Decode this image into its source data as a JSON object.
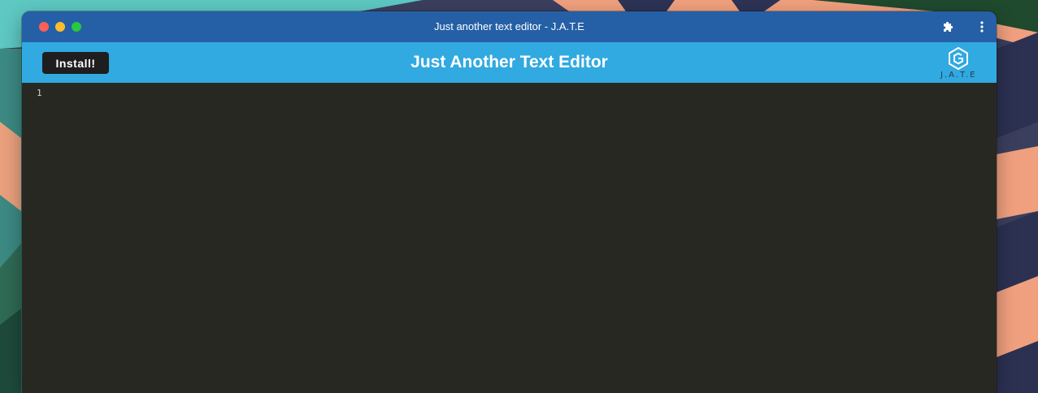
{
  "window": {
    "title": "Just another text editor - J.A.T.E"
  },
  "appbar": {
    "install_label": "Install!",
    "title": "Just Another Text Editor",
    "logo_text": "J.A.T.E"
  },
  "editor": {
    "line_numbers": [
      "1"
    ],
    "content": ""
  },
  "icons": {
    "extensions": "puzzle-icon",
    "menu": "kebab-menu-icon",
    "logo": "jate-logo-icon"
  },
  "colors": {
    "titlebar": "#2560a6",
    "appbar": "#31a9e1",
    "editor_bg": "#272822",
    "install_button": "#1e1e1e"
  }
}
